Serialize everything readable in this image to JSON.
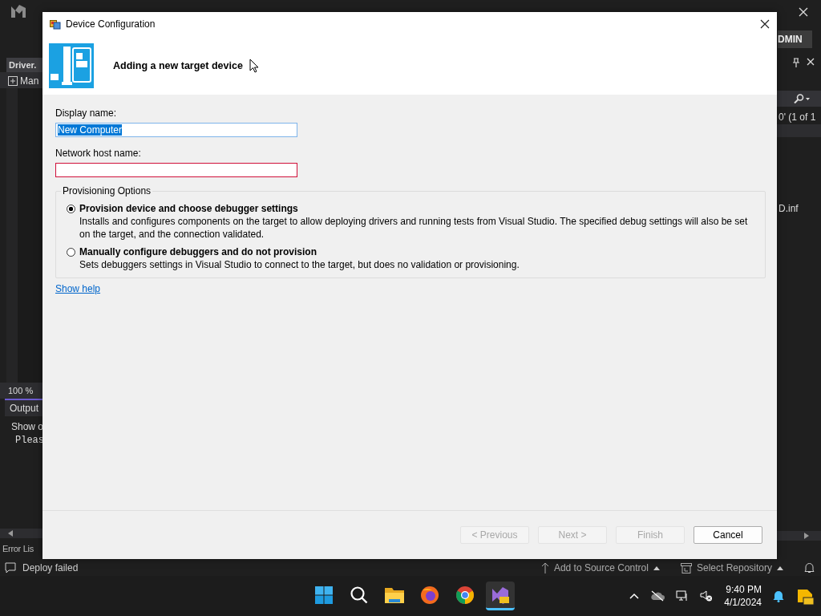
{
  "ide": {
    "admin_badge": "DMIN",
    "left_panel": {
      "tab": "Driver.",
      "toolbar_label": "Man",
      "zoom": "100 %",
      "output_title": "Output",
      "output_label": "Show o",
      "output_text": "Pleas",
      "error_tab": "Error Lis"
    },
    "right_panel": {
      "search_result": "0' (1 of 1",
      "file_item": "D.inf"
    }
  },
  "dialog": {
    "title": "Device Configuration",
    "heading": "Adding a new target device",
    "fields": [
      {
        "label": "Display name:",
        "value": "New Computer",
        "text_selected": true,
        "invalid": false
      },
      {
        "label": "Network host name:",
        "invalid": true
      }
    ],
    "group": {
      "legend": "Provisioning Options",
      "options": [
        {
          "title": "Provision device and choose debugger settings",
          "description": "Installs and configures components on the target to allow deploying drivers and running tests from Visual Studio. The specified debug settings will also be set on the target, and the connection validated.",
          "selected": true
        },
        {
          "title": "Manually configure debuggers and do not provision",
          "description": "Sets debuggers settings in Visual Studio to connect to the target, but does no validation or provisioning.",
          "selected": false
        }
      ]
    },
    "help_link": "Show help",
    "buttons": [
      {
        "label": "< Previous",
        "disabled": true
      },
      {
        "label": "Next >",
        "disabled": true
      },
      {
        "label": "Finish",
        "disabled": true
      },
      {
        "label": "Cancel",
        "disabled": false
      }
    ]
  },
  "status_bar": {
    "message": "Deploy failed",
    "items": [
      {
        "label": "Add to Source Control",
        "kind": "source"
      },
      {
        "label": "Select Repository",
        "kind": "repo"
      }
    ]
  },
  "taskbar": {
    "apps": [
      {
        "kind": "start",
        "active": false
      },
      {
        "kind": "search",
        "active": false
      },
      {
        "kind": "files",
        "active": false
      },
      {
        "kind": "firefox",
        "active": false
      },
      {
        "kind": "chrome",
        "active": false
      },
      {
        "kind": "vs",
        "active": true
      }
    ],
    "time": "9:40 PM",
    "date": "4/1/2024"
  }
}
